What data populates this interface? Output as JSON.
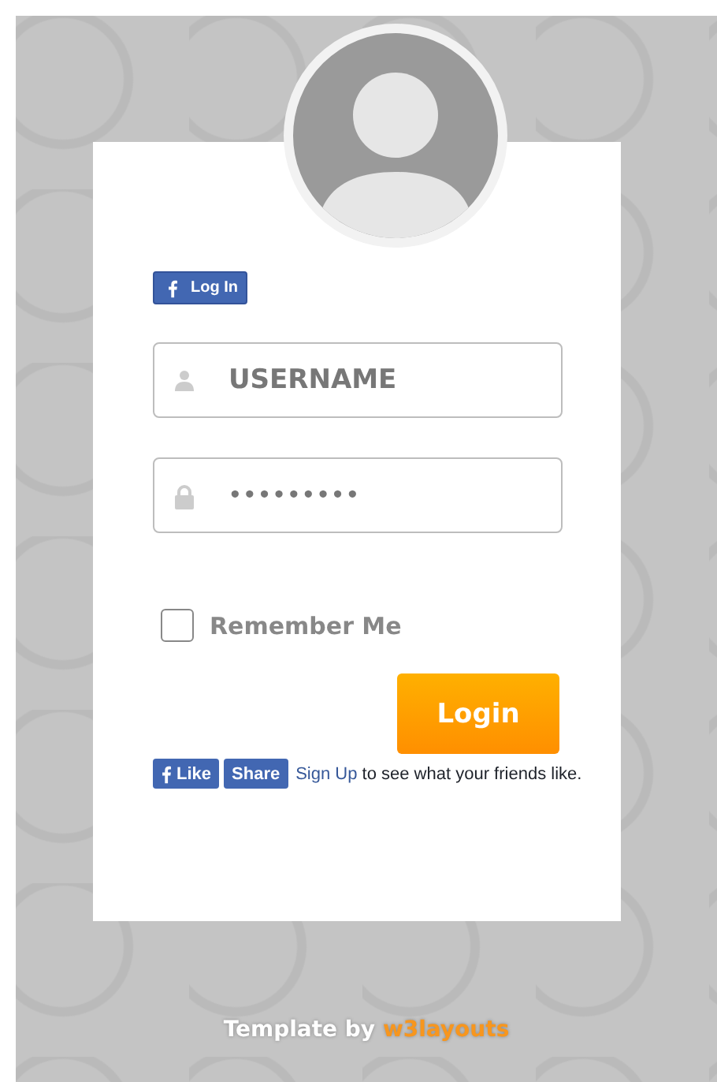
{
  "facebook_login": {
    "label": "Log In"
  },
  "username": {
    "placeholder": "USERNAME"
  },
  "password": {
    "value": "•••••••••"
  },
  "remember_me": {
    "label": "Remember Me",
    "checked": false
  },
  "login_button": {
    "label": "Login"
  },
  "like_bar": {
    "like": "Like",
    "share": "Share",
    "sign_up": "Sign Up",
    "text": "to see what your friends like."
  },
  "footer": {
    "text": "Template by",
    "link": "w3layouts"
  }
}
